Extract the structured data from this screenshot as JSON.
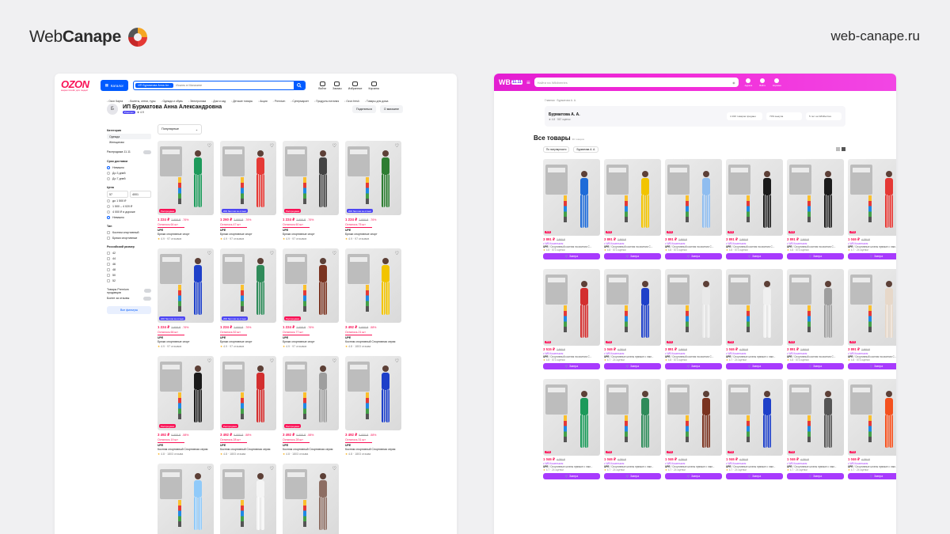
{
  "brand": {
    "name_light": "Web",
    "name_bold": "Canape",
    "url": "web-canape.ru"
  },
  "colors": {
    "ozon_blue": "#005bff",
    "ozon_pink": "#f91155",
    "wb_gradient": "#e31ed1",
    "wb_button": "#a73afd"
  },
  "ozon": {
    "logo": "OZON",
    "logo_sub": "маркетплейс для людей",
    "catalog_label": "Каталог",
    "search_chip": "ИП Бурматова Анна Ал...",
    "search_placeholder": "Искать в Магазине",
    "header_icons": [
      {
        "label": "Войти",
        "icon": "user-icon"
      },
      {
        "label": "Заказы",
        "icon": "box-icon"
      },
      {
        "label": "Избранное",
        "icon": "heart-icon"
      },
      {
        "label": "Корзина",
        "icon": "cart-icon"
      }
    ],
    "menu": [
      "Ozon Карта",
      "Билеты, отели, туры",
      "Одежда и обувь",
      "Электроника",
      "Дом и сад",
      "Детские товары",
      "Акции",
      "Premium",
      "Супермаркет",
      "Продукты питания",
      "Ozon fresh",
      "Товары для дома"
    ],
    "seller": {
      "avatar": "Б",
      "name": "ИП Бурматова Анна Александровна",
      "badge": "Premium",
      "rating": "★ 4.9"
    },
    "actions": [
      "Поделиться",
      "О магазине"
    ],
    "sidebar": {
      "category_title": "Категория",
      "categories": [
        "Одежда",
        "Женщинам"
      ],
      "sale_label": "Распродажа 11.11",
      "delivery_title": "Срок доставки",
      "delivery": [
        "Неважно",
        "До 3 дней",
        "До 7 дней"
      ],
      "price_title": "Цена",
      "price_from": "57",
      "price_to": "4001",
      "price_ranges": [
        "до 1 500 ₽",
        "1 500 – 4 020 ₽",
        "4 000 ₽ и дороже",
        "Неважно"
      ],
      "type_title": "Тип",
      "types": [
        "Костюм спортивный",
        "Брюки спортивные"
      ],
      "size_title": "Российский размер",
      "sizes": [
        "42",
        "44",
        "46",
        "48",
        "50",
        "52"
      ],
      "premium_label": "Товары Premium продавцов",
      "reviews_label": "Более за отзывы",
      "all_filters": "Все фильтры"
    },
    "sort": "Популярные",
    "products": [
      {
        "price": "1 224 ₽",
        "old": "2 958 ₽",
        "disc": "-76%",
        "stock": "Осталось 64 шт",
        "brand": "UPE",
        "title": "Брюки спортивные спорт",
        "rating": "4.9",
        "reviews": "97 отзывов",
        "tag": "Распродажа",
        "figure": "#1d9a5b"
      },
      {
        "price": "1 260 ₽",
        "old": "2 958 ₽",
        "disc": "-76%",
        "stock": "Осталось 47 шт",
        "brand": "UPE",
        "title": "Брюки спортивные спорт",
        "rating": "4.9",
        "reviews": "97 отзывов",
        "tag": "200 баллов за отзыв",
        "figure": "#e53935"
      },
      {
        "price": "1 224 ₽",
        "old": "2 958 ₽",
        "disc": "-76%",
        "stock": "Осталось 60 шт",
        "brand": "UPE",
        "title": "Брюки спортивные спорт",
        "rating": "4.9",
        "reviews": "97 отзывов",
        "tag": "Распродажа",
        "figure": "#444444"
      },
      {
        "price": "1 224 ₽",
        "old": "2 958 ₽",
        "disc": "-76%",
        "stock": "Осталось 75 шт",
        "brand": "UPE",
        "title": "Брюки спортивные спорт",
        "rating": "4.9",
        "reviews": "97 отзывов",
        "tag": "200 баллов за отзыв",
        "figure": "#2e7d32"
      },
      {
        "price": "1 224 ₽",
        "old": "2 958 ₽",
        "disc": "-76%",
        "stock": "Осталось 66 шт",
        "brand": "UPE",
        "title": "Брюки спортивные спорт",
        "rating": "4.9",
        "reviews": "97 отзывов",
        "tag": "200 баллов за отзыв",
        "figure": "#1e40c9"
      },
      {
        "price": "1 224 ₽",
        "old": "2 958 ₽",
        "disc": "-76%",
        "stock": "Осталось 52 шт",
        "brand": "UPE",
        "title": "Брюки спортивные спорт",
        "rating": "4.9",
        "reviews": "97 отзывов",
        "tag": "200 баллов за отзыв",
        "figure": "#2f8b5a"
      },
      {
        "price": "1 224 ₽",
        "old": "2 958 ₽",
        "disc": "-76%",
        "stock": "Осталось 77 шт",
        "brand": "UPE",
        "title": "Брюки спортивные спорт",
        "rating": "4.9",
        "reviews": "97 отзывов",
        "tag": "Распродажа",
        "figure": "#7a3320"
      },
      {
        "price": "3 492 ₽",
        "old": "6 958 ₽",
        "disc": "-58%",
        "stock": "Осталось 21 шт",
        "brand": "UPE",
        "title": "Костюм спортивный Спортивная серия",
        "rating": "4.8",
        "reviews": "1803 отзыва",
        "tag": "",
        "figure": "#f2c400"
      },
      {
        "price": "3 492 ₽",
        "old": "6 958 ₽",
        "disc": "-58%",
        "stock": "Осталось 19 шт",
        "brand": "UPE",
        "title": "Костюм спортивный Спортивная серия",
        "rating": "4.8",
        "reviews": "1803 отзыва",
        "tag": "Распродажа",
        "figure": "#1b1b1b"
      },
      {
        "price": "3 492 ₽",
        "old": "6 958 ₽",
        "disc": "-58%",
        "stock": "Осталось 28 шт",
        "brand": "UPE",
        "title": "Костюм спортивный Спортивная серия",
        "rating": "4.8",
        "reviews": "1803 отзыва",
        "tag": "Распродажа",
        "figure": "#d32f2f"
      },
      {
        "price": "3 492 ₽",
        "old": "6 958 ₽",
        "disc": "-58%",
        "stock": "Осталось 28 шт",
        "brand": "UPE",
        "title": "Костюм спортивный Спортивная серия",
        "rating": "4.8",
        "reviews": "1803 отзыва",
        "tag": "Распродажа",
        "figure": "#9e9e9e"
      },
      {
        "price": "3 492 ₽",
        "old": "6 958 ₽",
        "disc": "-58%",
        "stock": "Осталось 31 шт",
        "brand": "UPE",
        "title": "Костюм спортивный Спортивная серия",
        "rating": "4.8",
        "reviews": "1803 отзыва",
        "tag": "",
        "figure": "#1e40c9"
      },
      {
        "price": "",
        "old": "",
        "disc": "",
        "stock": "",
        "brand": "",
        "title": "",
        "rating": "",
        "reviews": "",
        "tag": "",
        "figure": "#90caf9"
      },
      {
        "price": "",
        "old": "",
        "disc": "",
        "stock": "",
        "brand": "",
        "title": "",
        "rating": "",
        "reviews": "",
        "tag": "",
        "figure": "#f5f5f5"
      },
      {
        "price": "",
        "old": "",
        "disc": "",
        "stock": "",
        "brand": "",
        "title": "",
        "rating": "",
        "reviews": "",
        "tag": "",
        "figure": "#8d6e63"
      }
    ]
  },
  "wb": {
    "logo": "WB",
    "logo_badge": "11.11",
    "search_placeholder": "Найти на Wildberries",
    "header_icons": [
      {
        "label": "Адреса",
        "icon": "location-icon"
      },
      {
        "label": "Войти",
        "icon": "user-icon"
      },
      {
        "label": "Корзина",
        "icon": "cart-icon"
      }
    ],
    "breadcrumbs": "Главная  ·  Бурматова А. А.",
    "seller_name": "Бурматова А. А.",
    "seller_meta": "★ 4.8 · 567 оценок",
    "stats": [
      "4 199 товаров продано",
      "70% выкупа",
      "5 лет на Wildberries"
    ],
    "heading": "Все товары",
    "heading_count": "96 товаров",
    "filters": [
      "По популярности",
      "Бурматова А. А."
    ],
    "cart_label": "Завтра",
    "products": [
      {
        "price": "3 891 ₽",
        "old": "7 868 ₽",
        "sub": "с WB Кошельком",
        "brand": "UPE",
        "title": "Спортивный костюм на молнии С...",
        "rating": "4.8",
        "reviews": "573 оценки",
        "disc": "-51%",
        "figure": "#1e6bd8"
      },
      {
        "price": "3 891 ₽",
        "old": "7 868 ₽",
        "sub": "с WB Кошельком",
        "brand": "UPE",
        "title": "Спортивный костюм на молнии С...",
        "rating": "4.8",
        "reviews": "573 оценки",
        "disc": "-51%",
        "figure": "#f2c400"
      },
      {
        "price": "3 891 ₽",
        "old": "7 868 ₽",
        "sub": "с WB Кошельком",
        "brand": "UPE",
        "title": "Спортивный костюм на молнии С...",
        "rating": "4.8",
        "reviews": "573 оценки",
        "disc": "-51%",
        "figure": "#8fbdf0"
      },
      {
        "price": "3 891 ₽",
        "old": "7 868 ₽",
        "sub": "с WB Кошельком",
        "brand": "UPE",
        "title": "Спортивный костюм на молнии С...",
        "rating": "4.8",
        "reviews": "573 оценки",
        "disc": "-51%",
        "figure": "#1b1b1b"
      },
      {
        "price": "3 891 ₽",
        "old": "7 868 ₽",
        "sub": "с WB Кошельком",
        "brand": "UPE",
        "title": "Спортивный костюм на молнии С...",
        "rating": "4.8",
        "reviews": "573 оценки",
        "disc": "-51%",
        "figure": "#1b1b1b"
      },
      {
        "price": "1 046 ₽",
        "old": "4 280 ₽",
        "sub": "с WB Кошельком",
        "brand": "UPE",
        "title": "Спортивные штаны прямые с лам...",
        "rating": "4.7",
        "reviews": "24 оценки",
        "disc": "-75%",
        "figure": "#e53935"
      },
      {
        "price": "3 515 ₽",
        "old": "7 868 ₽",
        "sub": "с WB Кошельком",
        "brand": "UPE",
        "title": "Спортивный костюм на молнии С...",
        "rating": "4.8",
        "reviews": "573 оценки",
        "disc": "-55%",
        "figure": "#d32f2f"
      },
      {
        "price": "1 046 ₽",
        "old": "4 280 ₽",
        "sub": "с WB Кошельком",
        "brand": "UPE",
        "title": "Спортивные штаны прямые с лам...",
        "rating": "4.7",
        "reviews": "24 оценки",
        "disc": "-75%",
        "figure": "#1e40c9"
      },
      {
        "price": "3 891 ₽",
        "old": "7 868 ₽",
        "sub": "с WB Кошельком",
        "brand": "UPE",
        "title": "Спортивный костюм на молнии С...",
        "rating": "4.8",
        "reviews": "573 оценки",
        "disc": "-51%",
        "figure": "#e9e9e9"
      },
      {
        "price": "1 046 ₽",
        "old": "4 280 ₽",
        "sub": "с WB Кошельком",
        "brand": "UPE",
        "title": "Спортивные штаны прямые с лам...",
        "rating": "4.7",
        "reviews": "24 оценки",
        "disc": "-75%",
        "figure": "#f0f0f0"
      },
      {
        "price": "3 891 ₽",
        "old": "7 868 ₽",
        "sub": "с WB Кошельком",
        "brand": "UPE",
        "title": "Спортивный костюм на молнии С...",
        "rating": "4.8",
        "reviews": "573 оценки",
        "disc": "-51%",
        "figure": "#9e9e9e"
      },
      {
        "price": "3 891 ₽",
        "old": "7 868 ₽",
        "sub": "с WB Кошельком",
        "brand": "UPE",
        "title": "Спортивный костюм на молнии С...",
        "rating": "4.8",
        "reviews": "573 оценки",
        "disc": "-51%",
        "figure": "#e7d8c9"
      },
      {
        "price": "1 046 ₽",
        "old": "4 280 ₽",
        "sub": "с WB Кошельком",
        "brand": "UPE",
        "title": "Спортивные штаны прямые с лам...",
        "rating": "4.7",
        "reviews": "24 оценки",
        "disc": "-75%",
        "figure": "#1d9a5b"
      },
      {
        "price": "1 046 ₽",
        "old": "4 280 ₽",
        "sub": "с WB Кошельком",
        "brand": "UPE",
        "title": "Спортивные штаны прямые с лам...",
        "rating": "4.7",
        "reviews": "24 оценки",
        "disc": "-75%",
        "figure": "#2f8b5a"
      },
      {
        "price": "1 046 ₽",
        "old": "4 280 ₽",
        "sub": "с WB Кошельком",
        "brand": "UPE",
        "title": "Спортивные штаны прямые с лам...",
        "rating": "4.7",
        "reviews": "24 оценки",
        "disc": "-75%",
        "figure": "#7a3320"
      },
      {
        "price": "1 046 ₽",
        "old": "4 280 ₽",
        "sub": "с WB Кошельком",
        "brand": "UPE",
        "title": "Спортивные штаны прямые с лам...",
        "rating": "4.7",
        "reviews": "24 оценки",
        "disc": "-75%",
        "figure": "#1e40c9"
      },
      {
        "price": "1 046 ₽",
        "old": "4 280 ₽",
        "sub": "с WB Кошельком",
        "brand": "UPE",
        "title": "Спортивные штаны прямые с лам...",
        "rating": "4.7",
        "reviews": "24 оценки",
        "disc": "-75%",
        "figure": "#555555"
      },
      {
        "price": "1 046 ₽",
        "old": "4 280 ₽",
        "sub": "с WB Кошельком",
        "brand": "UPE",
        "title": "Спортивные штаны прямые с лам...",
        "rating": "4.7",
        "reviews": "24 оценки",
        "disc": "-75%",
        "figure": "#f4511e"
      }
    ]
  }
}
